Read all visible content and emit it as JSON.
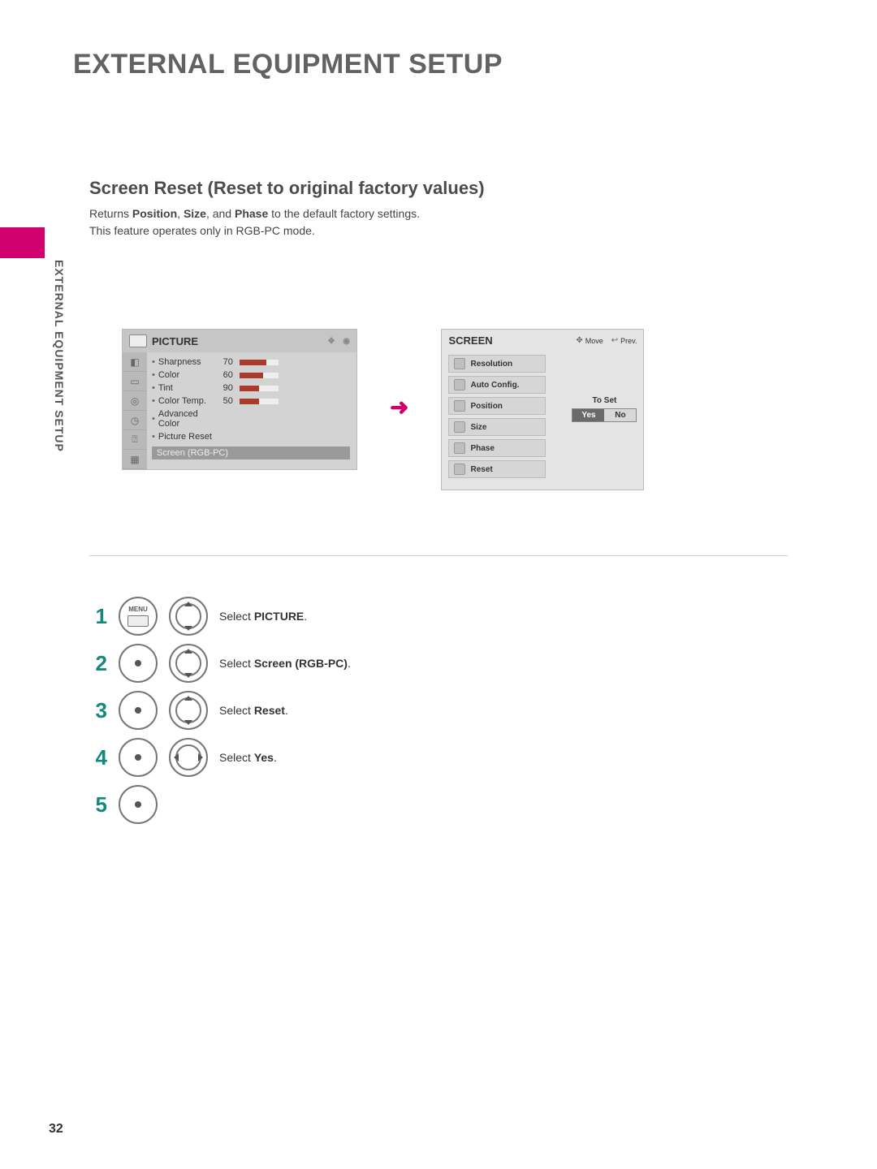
{
  "page_title": "EXTERNAL EQUIPMENT SETUP",
  "side_label": "EXTERNAL EQUIPMENT SETUP",
  "section": {
    "title": "Screen Reset (Reset to original factory values)",
    "desc_prefix": "Returns ",
    "desc_bold1": "Position",
    "desc_mid1": ", ",
    "desc_bold2": "Size",
    "desc_mid2": ", and ",
    "desc_bold3": "Phase",
    "desc_suffix": " to the default factory settings.",
    "desc_line2": "This feature operates only in RGB-PC mode."
  },
  "picture_panel": {
    "header": "PICTURE",
    "rows": [
      {
        "label": "Sharpness",
        "val": "70",
        "pct": 70
      },
      {
        "label": "Color",
        "val": "60",
        "pct": 60
      },
      {
        "label": "Tint",
        "val": "90",
        "pct": 50
      },
      {
        "label": "Color Temp.",
        "val": "50",
        "pct": 50
      }
    ],
    "adv": "Advanced Color",
    "preset": "Picture Reset",
    "screen_row": "Screen (RGB-PC)"
  },
  "screen_panel": {
    "header": "SCREEN",
    "move": "Move",
    "prev": "Prev.",
    "items": [
      "Resolution",
      "Auto Config.",
      "Position",
      "Size",
      "Phase",
      "Reset"
    ],
    "to_set": "To Set",
    "yes": "Yes",
    "no": "No"
  },
  "steps": [
    {
      "num": "1",
      "icons": [
        "menu",
        "updown"
      ],
      "prefix": "Select ",
      "bold": "PICTURE",
      "suffix": "."
    },
    {
      "num": "2",
      "icons": [
        "enter",
        "updown"
      ],
      "prefix": "Select ",
      "bold": "Screen (RGB-PC)",
      "suffix": "."
    },
    {
      "num": "3",
      "icons": [
        "enter",
        "updown"
      ],
      "prefix": "Select ",
      "bold": "Reset",
      "suffix": "."
    },
    {
      "num": "4",
      "icons": [
        "enter",
        "leftright"
      ],
      "prefix": "Select ",
      "bold": "Yes",
      "suffix": "."
    },
    {
      "num": "5",
      "icons": [
        "enter"
      ],
      "prefix": "",
      "bold": "",
      "suffix": ""
    }
  ],
  "menu_label": "MENU",
  "page_number": "32"
}
